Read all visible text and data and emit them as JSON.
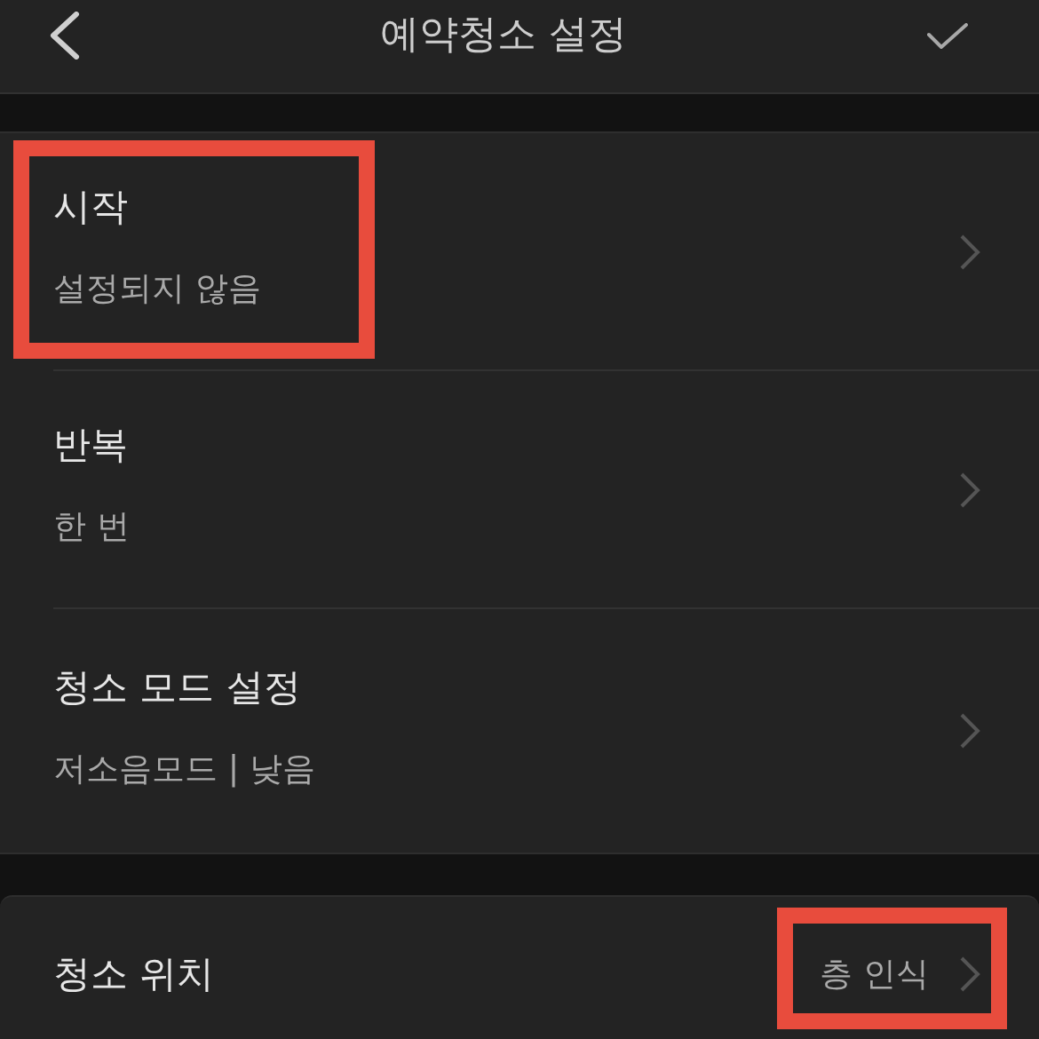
{
  "header": {
    "title": "예약청소 설정"
  },
  "sections": [
    {
      "items": [
        {
          "kind": "stacked",
          "label": "시작",
          "value": "설정되지 않음",
          "highlighted": true
        },
        {
          "kind": "stacked",
          "label": "반복",
          "value": "한 번",
          "highlighted": false
        },
        {
          "kind": "stacked",
          "label": "청소 모드 설정",
          "value": "저소음모드 | 낮음",
          "highlighted": false
        }
      ]
    },
    {
      "items": [
        {
          "kind": "inline",
          "label": "청소 위치",
          "value": "층 인식",
          "highlighted": true
        }
      ]
    }
  ]
}
